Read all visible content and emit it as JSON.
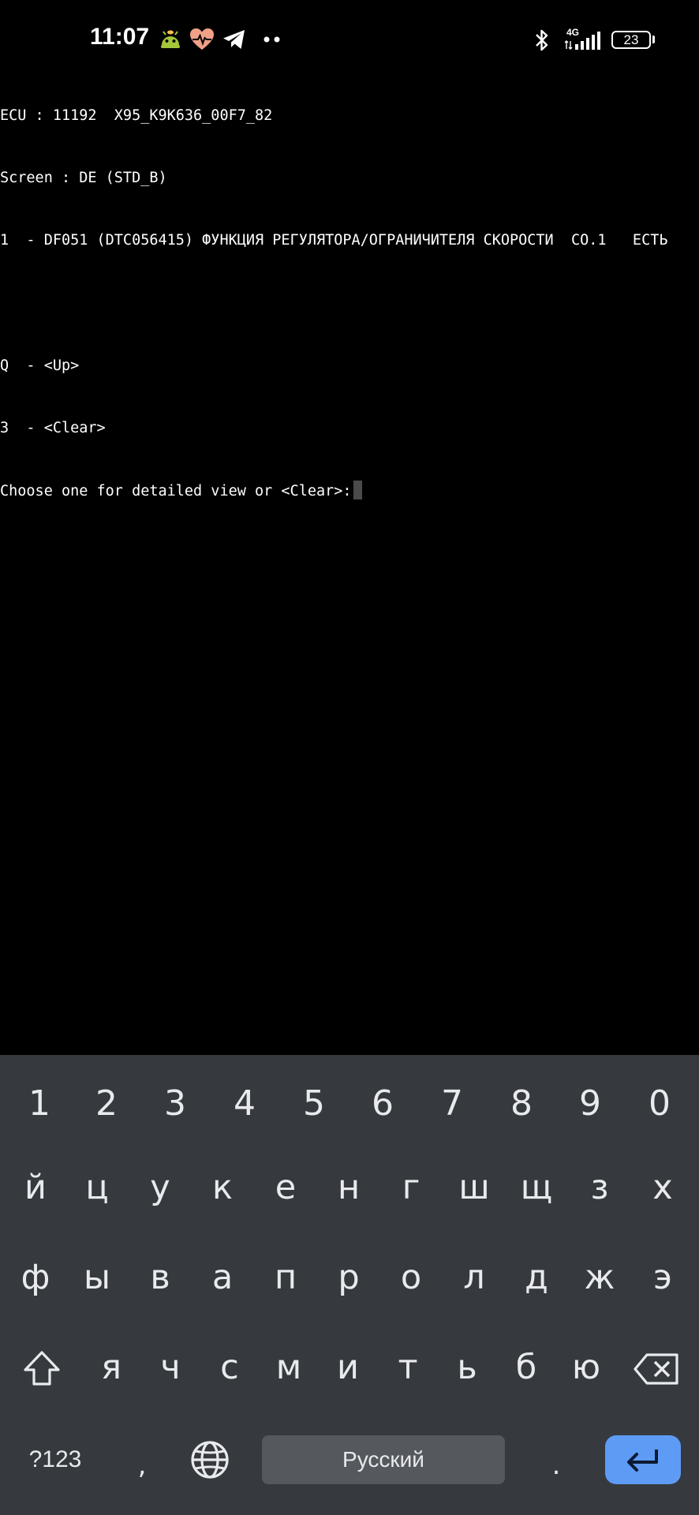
{
  "status_bar": {
    "time": "11:07",
    "network_type": "4G",
    "battery_level": "23",
    "icons": [
      "android-debug-icon",
      "health-heart-icon",
      "telegram-icon",
      "more-notifications-icon",
      "bluetooth-icon",
      "signal-icon",
      "battery-icon"
    ]
  },
  "terminal": {
    "lines": [
      "ECU : 11192  X95_K9K636_00F7_82",
      "Screen : DE (STD_B)",
      "1  - DF051 (DTC056415) ФУНКЦИЯ РЕГУЛЯТОРА/ОГРАНИЧИТЕЛЯ СКОРОСТИ  СО.1   ЕСТЬ",
      "",
      "Q  - <Up>",
      "3  - <Clear>",
      "Choose one for detailed view or <Clear>:"
    ]
  },
  "keyboard": {
    "digits": [
      "1",
      "2",
      "3",
      "4",
      "5",
      "6",
      "7",
      "8",
      "9",
      "0"
    ],
    "row1": [
      "й",
      "ц",
      "у",
      "к",
      "е",
      "н",
      "г",
      "ш",
      "щ",
      "з",
      "х"
    ],
    "row2": [
      "ф",
      "ы",
      "в",
      "а",
      "п",
      "р",
      "о",
      "л",
      "д",
      "ж",
      "э"
    ],
    "row3": [
      "я",
      "ч",
      "с",
      "м",
      "и",
      "т",
      "ь",
      "б",
      "ю"
    ],
    "symbols_label": "?123",
    "comma": ",",
    "space_label": "Русский",
    "period": ".",
    "colors": {
      "background": "#363a3f",
      "key_text": "#e8eaed",
      "space_bg": "#55595e",
      "enter_bg": "#5e9bf5"
    }
  }
}
